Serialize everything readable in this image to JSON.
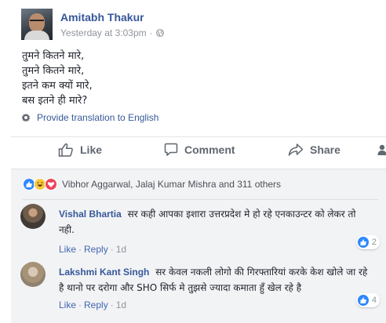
{
  "post": {
    "author": "Amitabh Thakur",
    "time": "Yesterday at 3:03pm",
    "separator": "·",
    "lines": [
      "तुमने कितने मारे,",
      "तुमने कितने मारे,",
      "इतने कम क्यों मारे,",
      "बस इतने ही मारे?"
    ],
    "translate_label": "Provide translation to English"
  },
  "actions": {
    "like": "Like",
    "comment": "Comment",
    "share": "Share"
  },
  "reactions": {
    "summary": "Vibhor Aggarwal, Jalaj Kumar Mishra and 311 others"
  },
  "comments": [
    {
      "name": "Vishal Bhartia",
      "text": "सर कही आपका इशारा उत्तरप्रदेश मे हो रहे एनकाउन्टर को लेकर तो नही.",
      "like": "Like",
      "reply": "Reply",
      "age": "1d",
      "likes": "2"
    },
    {
      "name": "Lakshmi Kant Singh",
      "text": "सर केवल नकली लोगो की गिरफ्तारियां करके केश खोले जा रहे है थानो पर दरोगा और SHO सिर्फ मे तुझसे ज्यादा कमाता हुँ खेल रहे है",
      "like": "Like",
      "reply": "Reply",
      "age": "1d",
      "likes": "4"
    }
  ],
  "colors": {
    "link": "#365899",
    "muted": "#90949c",
    "like_blue": "#2d88ff",
    "panel": "#f2f3f5"
  }
}
